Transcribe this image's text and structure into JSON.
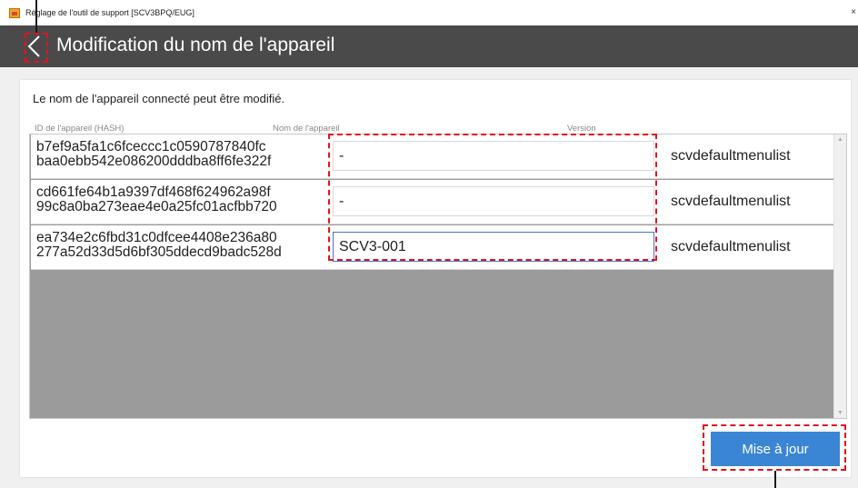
{
  "window": {
    "title": "Réglage de l'outil de support [SCV3BPQ/EUG]",
    "close_glyph": "×",
    "icon": "app-icon"
  },
  "header": {
    "title": "Modification du nom de l'appareil",
    "back_icon": "chevron-left-icon",
    "background": "#4a4a4a"
  },
  "main": {
    "instruction": "Le nom de l'appareil connecté peut être modifié.",
    "columns": [
      "ID de l'appareil (HASH)",
      "Nom de l'appareil",
      "Version"
    ],
    "rows": [
      {
        "hash_line1": "b7ef9a5fa1c6fceccc1c0590787840fc",
        "hash_line2": "baa0ebb542e086200dddba8ff6fe322f",
        "name": "-",
        "version": "scvdefaultmenulist"
      },
      {
        "hash_line1": "cd661fe64b1a9397df468f624962a98f",
        "hash_line2": "99c8a0ba273eae4e0a25fc01acfbb720",
        "name": "-",
        "version": "scvdefaultmenulist"
      },
      {
        "hash_line1": "ea734e2c6fbd31c0dfcee4408e236a80",
        "hash_line2": "277a52d33d5d6bf305ddecd9badc528d",
        "name": "SCV3-001",
        "version": "scvdefaultmenulist"
      }
    ],
    "update_button": "Mise à jour"
  },
  "colors": {
    "accent": "#3a86d4",
    "callout": "#e0141e"
  }
}
